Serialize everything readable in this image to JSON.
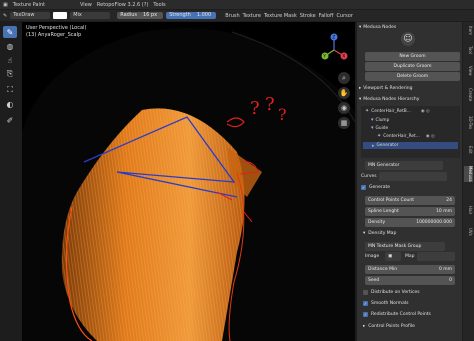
{
  "topbar": {
    "items": [
      "Texture Paint",
      "View",
      "RetopoFlow 3.2.6 (?)",
      "Tools"
    ]
  },
  "header": {
    "brush_name": "TexDraw",
    "blend_mode": "Mix",
    "radius_label": "Radius",
    "radius_value": "16 px",
    "strength_label": "Strength",
    "strength_value": "1.000",
    "menus": [
      "Brush",
      "Texture",
      "Texture Mask",
      "Stroke",
      "Falloff",
      "Cursor"
    ],
    "color_swatch": "#ffffff"
  },
  "viewport": {
    "line1": "User Perspective (Local)",
    "line2": "(13) AnyaRoger_Scalp",
    "hair_color": "#e07a1a",
    "annotation_red": "#e02020",
    "annotation_blue": "#2a3cc8"
  },
  "navigation": {
    "axis_x": "X",
    "axis_y": "Y",
    "axis_z": "Z"
  },
  "panel": {
    "section_medusa": "Medusa Nodes",
    "new_groom": "New Groom",
    "duplicate_groom": "Duplicate Groom",
    "delete_groom": "Delete Groom",
    "section_viewport": "Viewport & Rendering",
    "section_hierarchy": "Medusa Nodes Hierarchy",
    "tree": [
      {
        "label": "CenterHair_RetB..."
      },
      {
        "label": "Clump"
      },
      {
        "label": "Guide"
      },
      {
        "label": "CenterHair_Ret..."
      },
      {
        "label": "Generator"
      }
    ],
    "node_name": "MN Generator",
    "curves_label": "Curves",
    "generate_label": "Generate",
    "control_points_label": "Control Points Count",
    "control_points_value": "24",
    "spline_length_label": "Spline Lenght",
    "spline_length_value": "10 mm",
    "density_label": "Density",
    "density_value": "100000000.000",
    "density_map_label": "Density Map",
    "mask_group_label": "MN Texture Mask Group",
    "image_label": "Image",
    "map_label": "Map",
    "distance_min_label": "Distance Min",
    "distance_min_value": "0 mm",
    "seed_label": "Seed",
    "seed_value": "0",
    "distribute_label": "Distribute on Vertices",
    "smooth_normals_label": "Smooth Normals",
    "redistribute_label": "Redistribute Control Points",
    "profile_label": "Control Points Profile"
  },
  "side_tabs": [
    "Item",
    "Tool",
    "View",
    "Create",
    "3D-Tex",
    "Edit",
    "Medusa",
    "Hair",
    "UVs"
  ]
}
